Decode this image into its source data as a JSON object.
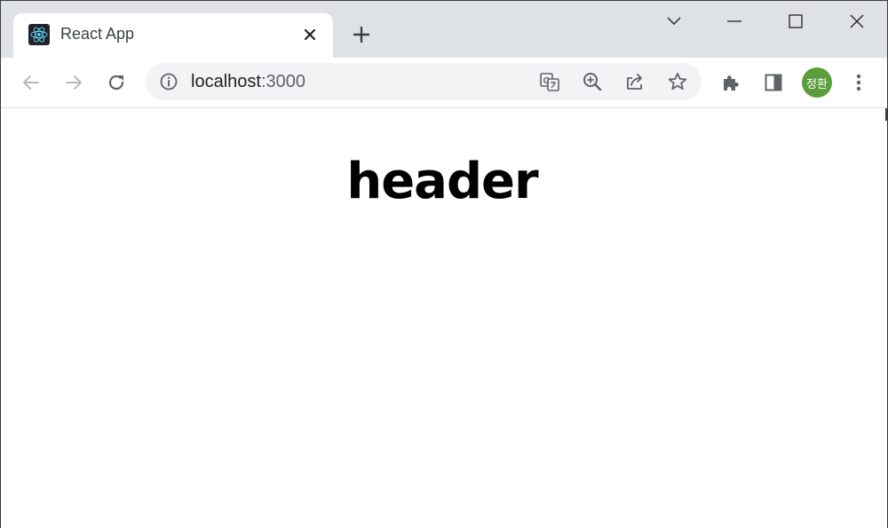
{
  "tab": {
    "title": "React App",
    "favicon_icon": "react-logo-icon",
    "close_icon": "close-icon"
  },
  "tabstrip": {
    "new_tab_icon": "plus-icon",
    "search_tabs_icon": "chevron-down-icon"
  },
  "window_controls": [
    "minimize-icon",
    "maximize-icon",
    "close-icon"
  ],
  "toolbar": {
    "back_icon": "arrow-left-icon",
    "forward_icon": "arrow-right-icon",
    "reload_icon": "reload-icon",
    "site_info_icon": "info-icon",
    "url_host": "localhost",
    "url_port": ":3000",
    "translate_icon": "translate-icon",
    "zoom_icon": "zoom-in-icon",
    "share_icon": "share-icon",
    "bookmark_icon": "star-icon",
    "extensions_icon": "puzzle-icon",
    "side_panel_icon": "side-panel-icon",
    "profile_label": "정환",
    "menu_icon": "kebab-menu-icon"
  },
  "colors": {
    "tabstrip_bg": "#dee1e6",
    "omnibox_bg": "#f1f3f4",
    "avatar_bg": "#5a9e3a",
    "icon": "#5f6368"
  },
  "page": {
    "heading": "header"
  }
}
